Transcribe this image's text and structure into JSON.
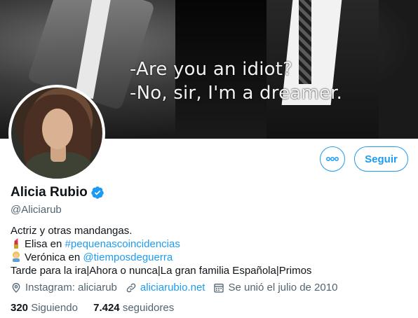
{
  "banner": {
    "line1": "-Are you an idiot?",
    "line2": "-No, sir, I'm a dreamer."
  },
  "actions": {
    "follow_label": "Seguir",
    "more_label": "•••"
  },
  "profile": {
    "name": "Alicia Rubio",
    "handle": "@Aliciarub",
    "verified": true
  },
  "bio": {
    "line1": "Actriz y otras mandangas.",
    "line2_prefix": "Elisa en ",
    "line2_hashtag": "#pequenascoincidencias",
    "line3_prefix": "Verónica en ",
    "line3_mention": "@tiemposdeguerra",
    "line4": "Tarde para la ira|Ahora o nunca|La gran familia Española|Primos"
  },
  "meta": {
    "location": "Instagram: aliciarub",
    "website": "aliciarubio.net",
    "joined": "Se unió el julio de 2010"
  },
  "stats": {
    "following_count": "320",
    "following_label": "Siguiendo",
    "followers_count": "7.424",
    "followers_label": "seguidores"
  },
  "colors": {
    "accent": "#1d9bf0",
    "secondary_text": "#536471",
    "primary_text": "#0f1419"
  },
  "icons": [
    "more-icon",
    "verified-badge-icon",
    "lipstick-icon",
    "person-blond-icon",
    "location-icon",
    "link-icon",
    "calendar-icon"
  ]
}
